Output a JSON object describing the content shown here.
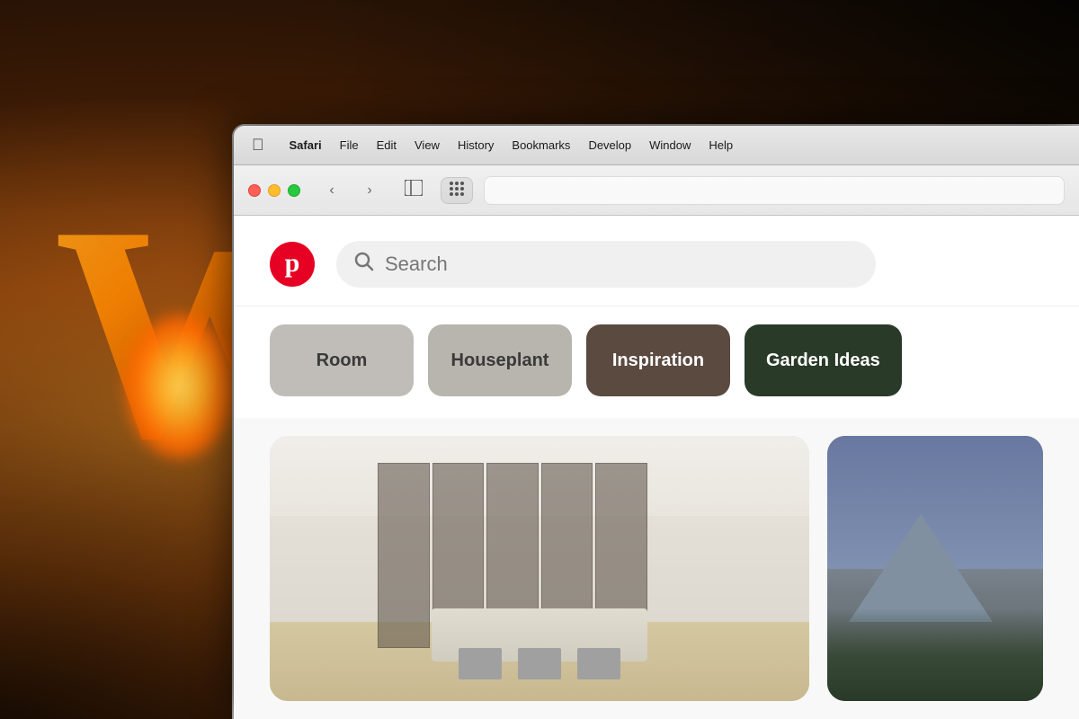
{
  "background": {
    "letter": "W"
  },
  "menu_bar": {
    "apple_symbol": "",
    "app_name": "Safari",
    "items": [
      "File",
      "Edit",
      "View",
      "History",
      "Bookmarks",
      "Develop",
      "Window",
      "Help"
    ]
  },
  "browser": {
    "back_icon": "‹",
    "forward_icon": "›",
    "sidebar_icon": "⊡",
    "grid_icon": "⠿"
  },
  "pinterest": {
    "logo_letter": "p",
    "search_placeholder": "Search",
    "categories": [
      {
        "id": "room",
        "label": "Room",
        "style": "light-gray"
      },
      {
        "id": "houseplant",
        "label": "Houseplant",
        "style": "light-tan"
      },
      {
        "id": "inspiration",
        "label": "Inspiration",
        "style": "dark-brown"
      },
      {
        "id": "garden-ideas",
        "label": "Garden Ideas",
        "style": "dark-green"
      }
    ]
  }
}
